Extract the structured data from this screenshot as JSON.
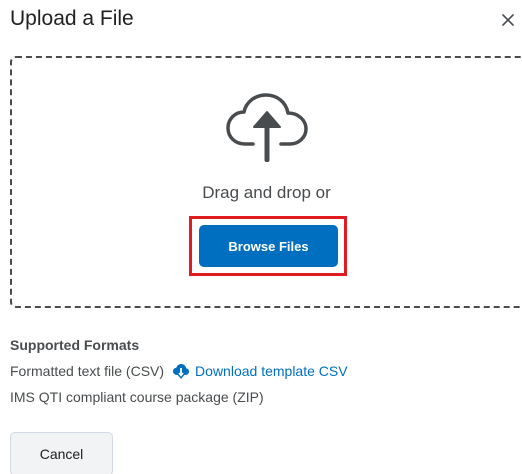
{
  "dialog": {
    "title": "Upload a File",
    "close_label": "×"
  },
  "dropzone": {
    "icon": "cloud-upload-icon",
    "drag_text": "Drag and drop or",
    "browse_label": "Browse Files"
  },
  "formats": {
    "heading": "Supported Formats",
    "items": [
      {
        "text": "Formatted text file (CSV)",
        "link_label": "Download template CSV",
        "link_icon": "cloud-download-icon"
      },
      {
        "text": "IMS QTI compliant course package (ZIP)"
      }
    ]
  },
  "footer": {
    "cancel_label": "Cancel"
  },
  "colors": {
    "primary": "#006fbf",
    "highlight": "#e01b22",
    "text": "#494c4e"
  }
}
